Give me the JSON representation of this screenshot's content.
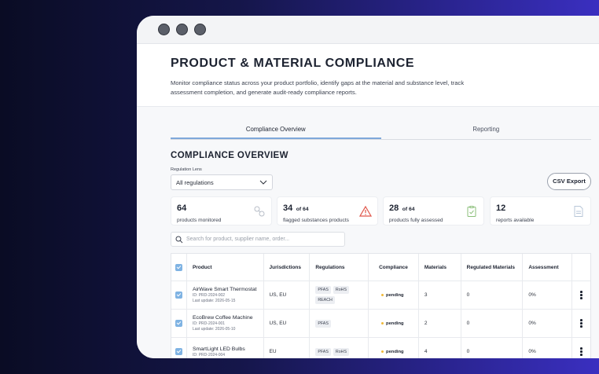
{
  "window": {
    "title": "PRODUCT & MATERIAL COMPLIANCE",
    "description": "Monitor compliance status across your product portfolio, identify gaps at the material and substance level, track assessment completion, and generate audit-ready compliance reports."
  },
  "tabs": [
    {
      "label": "Compliance Overview",
      "active": true
    },
    {
      "label": "Reporting",
      "active": false
    }
  ],
  "section_title": "COMPLIANCE OVERVIEW",
  "filter": {
    "label": "Regulation Lens",
    "value": "All regulations"
  },
  "export_button": "CSV Export",
  "stats": [
    {
      "value": "64",
      "of": "",
      "label": "products monitored",
      "icon": "molecule-icon"
    },
    {
      "value": "34",
      "of": "of 64",
      "label": "flagged substances products",
      "icon": "warning-icon"
    },
    {
      "value": "28",
      "of": "of 64",
      "label": "products fully assessed",
      "icon": "clipboard-check-icon"
    },
    {
      "value": "12",
      "of": "",
      "label": "reports available",
      "icon": "document-icon"
    }
  ],
  "search": {
    "placeholder": "Search for product, supplier name, order..."
  },
  "table": {
    "columns": [
      "Product",
      "Jurisdictions",
      "Regulations",
      "Compliance",
      "Materials",
      "Regulated Materials",
      "Assessment"
    ],
    "rows": [
      {
        "name": "AirWave Smart Thermostat",
        "id": "ID: PRD-2024-002",
        "updated": "Last update: 2026-05-15",
        "jurisdictions": "US, EU",
        "regulations": [
          "PFAS",
          "RoHS",
          "REACH"
        ],
        "compliance": "pending",
        "materials": "3",
        "regulated": "0",
        "assessment": "0%"
      },
      {
        "name": "EcoBrew Coffee Machine",
        "id": "ID: PRD-2024-001",
        "updated": "Last update: 2026-05-10",
        "jurisdictions": "US, EU",
        "regulations": [
          "PFAS"
        ],
        "compliance": "pending",
        "materials": "2",
        "regulated": "0",
        "assessment": "0%"
      },
      {
        "name": "SmartLight LED Bulbs",
        "id": "ID: PRD-2024-004",
        "updated": "",
        "jurisdictions": "EU",
        "regulations": [
          "PFAS",
          "RoHS"
        ],
        "compliance": "pending",
        "materials": "4",
        "regulated": "0",
        "assessment": "0%"
      }
    ]
  },
  "colors": {
    "accent": "#7fb3e3",
    "pending": "#f0b93a",
    "text": "#1c2230"
  }
}
